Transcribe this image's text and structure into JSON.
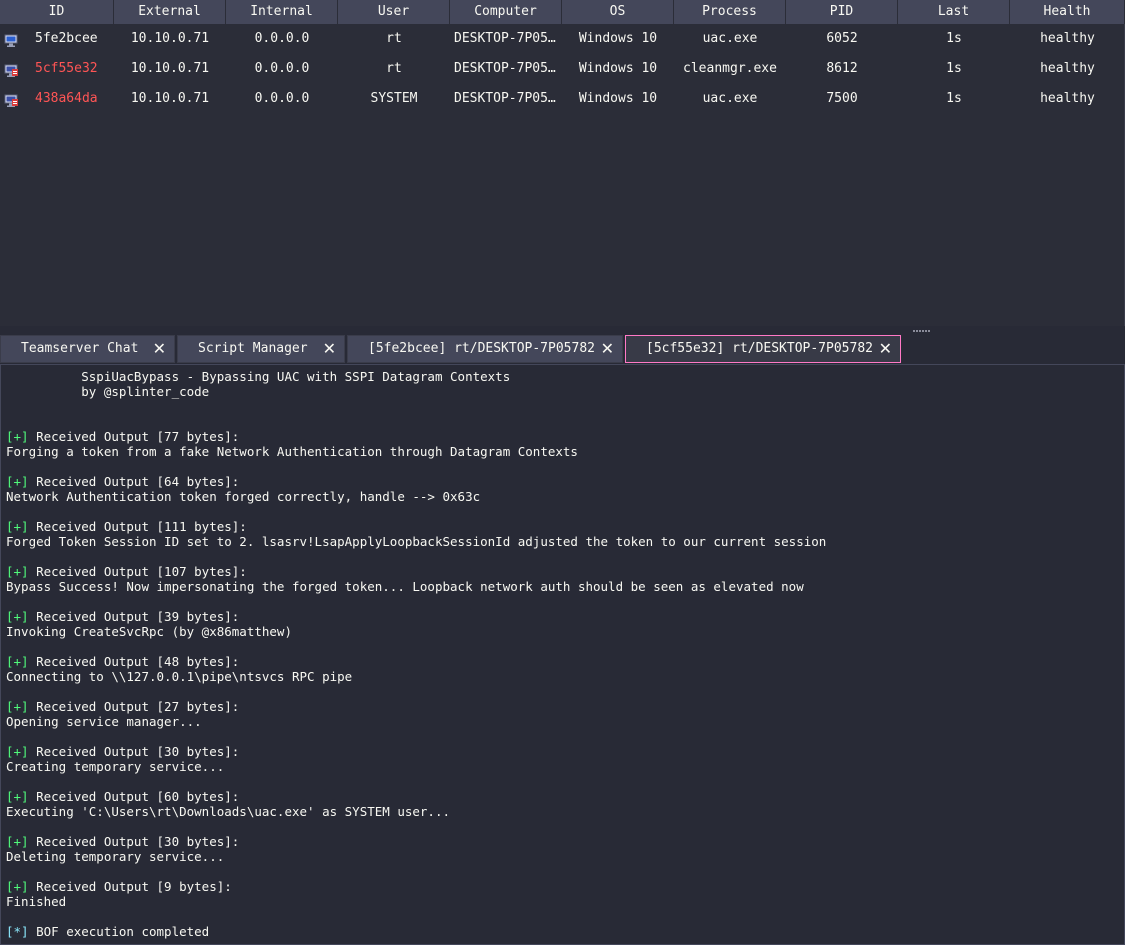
{
  "table": {
    "columns": [
      "ID",
      "External",
      "Internal",
      "User",
      "Computer",
      "OS",
      "Process",
      "PID",
      "Last",
      "Health"
    ],
    "rows": [
      {
        "id": "5fe2bcee",
        "external": "10.10.0.71",
        "internal": "0.0.0.0",
        "user": "rt",
        "computer": "DESKTOP-7P057…",
        "os": "Windows 10",
        "process": "uac.exe",
        "pid": "6052",
        "last": "1s",
        "health": "healthy",
        "icon": "monitor-icon",
        "elevated": false
      },
      {
        "id": "5cf55e32",
        "external": "10.10.0.71",
        "internal": "0.0.0.0",
        "user": "rt",
        "computer": "DESKTOP-7P057…",
        "os": "Windows 10",
        "process": "cleanmgr.exe",
        "pid": "8612",
        "last": "1s",
        "health": "healthy",
        "icon": "elevated-monitor-icon",
        "elevated": true
      },
      {
        "id": "438a64da",
        "external": "10.10.0.71",
        "internal": "0.0.0.0",
        "user": "SYSTEM",
        "computer": "DESKTOP-7P057…",
        "os": "Windows 10",
        "process": "uac.exe",
        "pid": "7500",
        "last": "1s",
        "health": "healthy",
        "icon": "elevated-monitor-icon",
        "elevated": true
      }
    ]
  },
  "tabs": [
    {
      "label": "Teamserver Chat",
      "close": "✕",
      "active": false
    },
    {
      "label": "Script Manager",
      "close": "✕",
      "active": false
    },
    {
      "label": "[5fe2bcee] rt/DESKTOP-7P05782",
      "close": "✕",
      "active": false
    },
    {
      "label": "[5cf55e32] rt/DESKTOP-7P05782",
      "close": "✕",
      "active": true
    }
  ],
  "console": {
    "lines": [
      {
        "text": "          SspiUacBypass - Bypassing UAC with SSPI Datagram Contexts"
      },
      {
        "text": "          by @splinter_code"
      },
      {
        "text": ""
      },
      {
        "text": ""
      },
      {
        "prefix": "[+]",
        "text": " Received Output [77 bytes]:"
      },
      {
        "text": "Forging a token from a fake Network Authentication through Datagram Contexts"
      },
      {
        "text": ""
      },
      {
        "prefix": "[+]",
        "text": " Received Output [64 bytes]:"
      },
      {
        "text": "Network Authentication token forged correctly, handle --> 0x63c"
      },
      {
        "text": ""
      },
      {
        "prefix": "[+]",
        "text": " Received Output [111 bytes]:"
      },
      {
        "text": "Forged Token Session ID set to 2. lsasrv!LsapApplyLoopbackSessionId adjusted the token to our current session"
      },
      {
        "text": ""
      },
      {
        "prefix": "[+]",
        "text": " Received Output [107 bytes]:"
      },
      {
        "text": "Bypass Success! Now impersonating the forged token... Loopback network auth should be seen as elevated now"
      },
      {
        "text": ""
      },
      {
        "prefix": "[+]",
        "text": " Received Output [39 bytes]:"
      },
      {
        "text": "Invoking CreateSvcRpc (by @x86matthew)"
      },
      {
        "text": ""
      },
      {
        "prefix": "[+]",
        "text": " Received Output [48 bytes]:"
      },
      {
        "text": "Connecting to \\\\127.0.0.1\\pipe\\ntsvcs RPC pipe"
      },
      {
        "text": ""
      },
      {
        "prefix": "[+]",
        "text": " Received Output [27 bytes]:"
      },
      {
        "text": "Opening service manager..."
      },
      {
        "text": ""
      },
      {
        "prefix": "[+]",
        "text": " Received Output [30 bytes]:"
      },
      {
        "text": "Creating temporary service..."
      },
      {
        "text": ""
      },
      {
        "prefix": "[+]",
        "text": " Received Output [60 bytes]:"
      },
      {
        "text": "Executing 'C:\\Users\\rt\\Downloads\\uac.exe' as SYSTEM user..."
      },
      {
        "text": ""
      },
      {
        "prefix": "[+]",
        "text": " Received Output [30 bytes]:"
      },
      {
        "text": "Deleting temporary service..."
      },
      {
        "text": ""
      },
      {
        "prefix": "[+]",
        "text": " Received Output [9 bytes]:"
      },
      {
        "text": "Finished"
      },
      {
        "text": ""
      },
      {
        "prefix": "[*]",
        "text": " BOF execution completed"
      }
    ]
  },
  "colors": {
    "background": "#282a36",
    "header": "#44475a",
    "elevated_id": "#ff5555",
    "success_prefix": "#50fa7b",
    "info_prefix": "#8be9fd",
    "active_tab_border": "#ff79c6"
  }
}
